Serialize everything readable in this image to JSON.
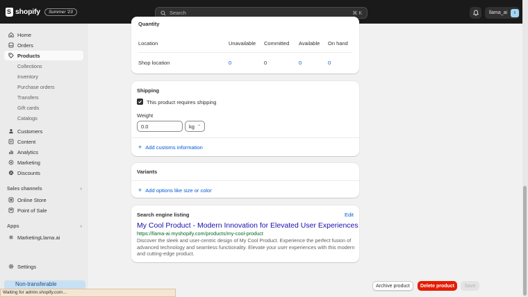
{
  "topbar": {
    "brand": "shopify",
    "edition": "Summer '23",
    "search_placeholder": "Search",
    "search_shortcut": "⌘ K",
    "user_name": "llama_ai",
    "avatar_initials": "ll"
  },
  "sidebar": {
    "main": [
      {
        "label": "Home",
        "icon": "home-icon"
      },
      {
        "label": "Orders",
        "icon": "orders-icon"
      },
      {
        "label": "Products",
        "icon": "tag-icon",
        "active": true
      }
    ],
    "product_sub": [
      "Collections",
      "Inventory",
      "Purchase orders",
      "Transfers",
      "Gift cards",
      "Catalogs"
    ],
    "more": [
      {
        "label": "Customers",
        "icon": "person-icon"
      },
      {
        "label": "Content",
        "icon": "content-icon"
      },
      {
        "label": "Analytics",
        "icon": "chart-icon"
      },
      {
        "label": "Marketing",
        "icon": "target-icon"
      },
      {
        "label": "Discounts",
        "icon": "discount-icon"
      }
    ],
    "sales_channels_label": "Sales channels",
    "channels": [
      {
        "label": "Online Store",
        "icon": "store-icon"
      },
      {
        "label": "Point of Sale",
        "icon": "pos-icon"
      }
    ],
    "apps_label": "Apps",
    "apps": [
      {
        "label": "MarketingLlama.ai",
        "icon": "app-icon"
      }
    ],
    "settings_label": "Settings",
    "nontransferable_label": "Non-transferable",
    "status_tooltip": "Waiting for admin.shopify.com..."
  },
  "quantity_card": {
    "title": "Quantity",
    "headers": [
      "Location",
      "Unavailable",
      "Committed",
      "Available",
      "On hand"
    ],
    "row": {
      "location": "Shop location",
      "unavailable": "0",
      "committed": "0",
      "available": "0",
      "on_hand": "0"
    }
  },
  "shipping_card": {
    "title": "Shipping",
    "requires_shipping_label": "This product requires shipping",
    "requires_shipping_checked": true,
    "weight_label": "Weight",
    "weight_value": "0.0",
    "unit_value": "kg",
    "customs_link": "Add customs information"
  },
  "variants_card": {
    "title": "Variants",
    "add_options_link": "Add options like size or color"
  },
  "seo_card": {
    "title": "Search engine listing",
    "edit_label": "Edit",
    "page_title": "My Cool Product - Modern Innovation for Elevated User Experiences",
    "url": "https://llama-ai.myshopify.com/products/my-cool-product",
    "description": "Discover the sleek and user-centric design of My Cool Product. Experience the perfect fusion of advanced technology and seamless functionality. Elevate your user experiences with this modern and cutting-edge product."
  },
  "footer_actions": {
    "archive_label": "Archive product",
    "delete_label": "Delete product",
    "save_label": "Save"
  },
  "colors": {
    "link": "#005bd3",
    "danger": "#e51c00",
    "topbar": "#1a1a1a",
    "seo_title": "#1a0dab",
    "seo_url": "#006621"
  }
}
